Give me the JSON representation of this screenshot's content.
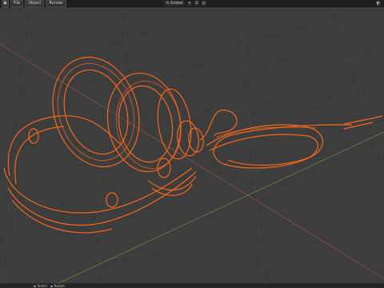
{
  "menu": {
    "items": [
      {
        "name": "file-menu",
        "label": "File"
      },
      {
        "name": "object-menu",
        "label": "Object"
      },
      {
        "name": "render-menu",
        "label": "Render"
      }
    ],
    "orientation_label": "Global"
  },
  "status": {
    "select_label": "Select",
    "rotate_label": "Rotate"
  },
  "colors": {
    "background": "#3d3d3d",
    "wire": "#ff6a1a",
    "grid": "#4b4b4b",
    "x_axis": "#b3544f",
    "y_axis": "#8ea43f"
  }
}
